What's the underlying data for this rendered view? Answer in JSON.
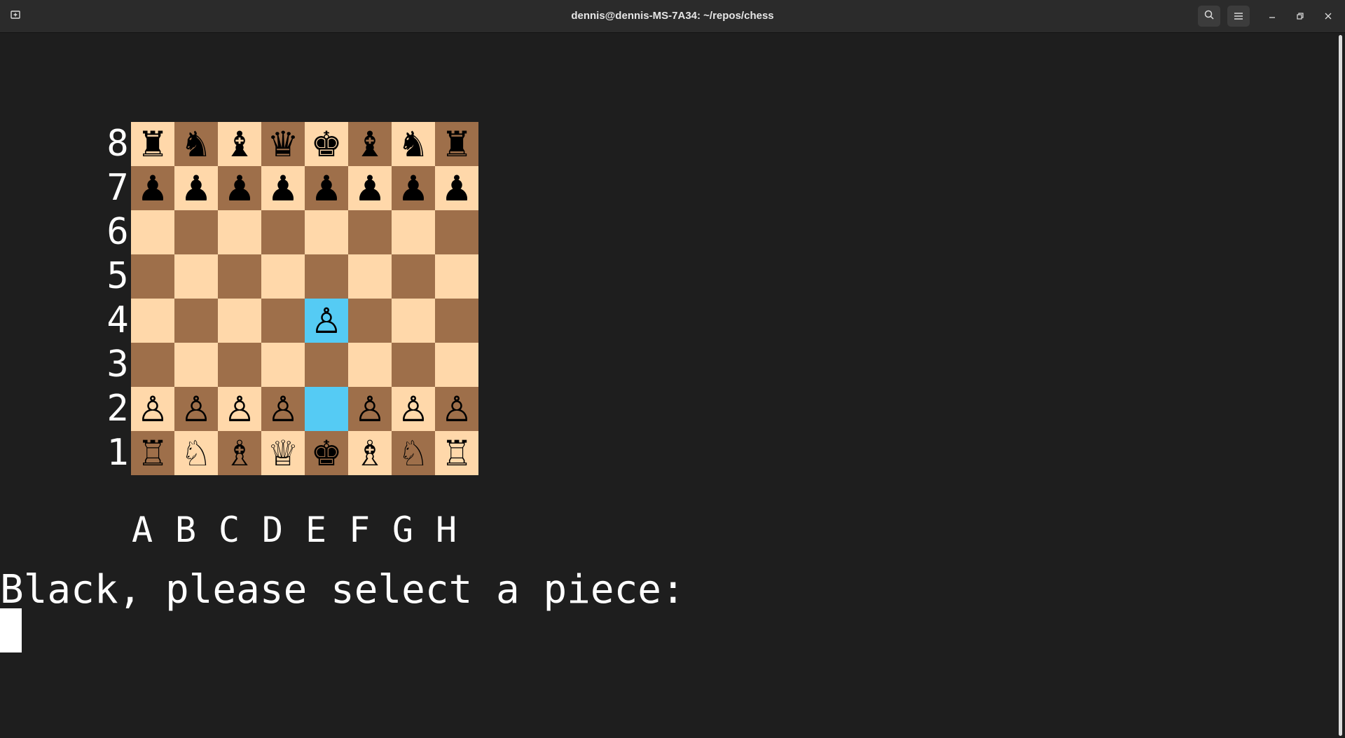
{
  "window": {
    "title": "dennis@dennis-MS-7A34: ~/repos/chess"
  },
  "icons": {
    "new_tab": "new-tab-icon",
    "search": "search-icon",
    "menu": "hamburger-menu-icon",
    "minimize": "minimize-icon",
    "restore": "restore-icon",
    "close": "close-icon"
  },
  "glyphs": {
    "new_tab": "⊞",
    "search": "⌕",
    "menu": "☰",
    "minimize": "–",
    "restore": "❐",
    "close": "✕"
  },
  "colors": {
    "light_square": "#ffd8aa",
    "dark_square": "#9e6f4a",
    "highlight": "#55cbf4"
  },
  "board": {
    "ranks": [
      "8",
      "7",
      "6",
      "5",
      "4",
      "3",
      "2",
      "1"
    ],
    "files": [
      "A",
      "B",
      "C",
      "D",
      "E",
      "F",
      "G",
      "H"
    ],
    "rows": [
      [
        "♜",
        "♞",
        "♝",
        "♛",
        "♚",
        "♝",
        "♞",
        "♜"
      ],
      [
        "♟",
        "♟",
        "♟",
        "♟",
        "♟",
        "♟",
        "♟",
        "♟"
      ],
      [
        "",
        "",
        "",
        "",
        "",
        "",
        "",
        ""
      ],
      [
        "",
        "",
        "",
        "",
        "",
        "",
        "",
        ""
      ],
      [
        "",
        "",
        "",
        "",
        "♙",
        "",
        "",
        ""
      ],
      [
        "",
        "",
        "",
        "",
        "",
        "",
        "",
        ""
      ],
      [
        "♙",
        "♙",
        "♙",
        "♙",
        "",
        "♙",
        "♙",
        "♙"
      ],
      [
        "♖",
        "♘",
        "♗",
        "♕",
        "♚",
        "♗",
        "♘",
        "♖"
      ]
    ],
    "highlighted": [
      "E4",
      "E2"
    ]
  },
  "terminal": {
    "prompt": "Black, please select a piece:"
  }
}
